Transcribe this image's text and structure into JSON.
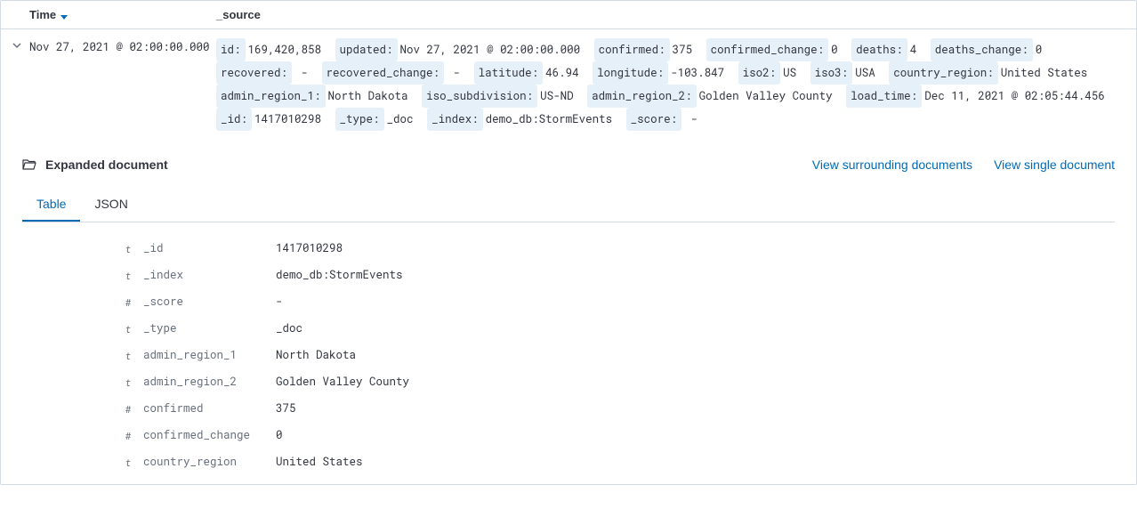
{
  "columns": {
    "time_label": "Time",
    "source_label": "_source"
  },
  "row": {
    "time": "Nov 27, 2021 @ 02:00:00.000",
    "source_fields": [
      {
        "key": "id:",
        "value": "169,420,858"
      },
      {
        "key": "updated:",
        "value": "Nov 27, 2021 @ 02:00:00.000"
      },
      {
        "key": "confirmed:",
        "value": "375"
      },
      {
        "key": "confirmed_change:",
        "value": "0"
      },
      {
        "key": "deaths:",
        "value": "4"
      },
      {
        "key": "deaths_change:",
        "value": "0"
      },
      {
        "key": "recovered:",
        "value": " - "
      },
      {
        "key": "recovered_change:",
        "value": " - "
      },
      {
        "key": "latitude:",
        "value": "46.94"
      },
      {
        "key": "longitude:",
        "value": "-103.847"
      },
      {
        "key": "iso2:",
        "value": "US"
      },
      {
        "key": "iso3:",
        "value": "USA"
      },
      {
        "key": "country_region:",
        "value": "United States"
      },
      {
        "key": "admin_region_1:",
        "value": "North Dakota"
      },
      {
        "key": "iso_subdivision:",
        "value": "US-ND"
      },
      {
        "key": "admin_region_2:",
        "value": "Golden Valley County"
      },
      {
        "key": "load_time:",
        "value": "Dec 11, 2021 @ 02:05:44.456"
      },
      {
        "key": "_id:",
        "value": "1417010298"
      },
      {
        "key": "_type:",
        "value": "_doc"
      },
      {
        "key": "_index:",
        "value": "demo_db:StormEvents"
      },
      {
        "key": "_score:",
        "value": " - "
      }
    ]
  },
  "expanded": {
    "title": "Expanded document",
    "link_surrounding": "View surrounding documents",
    "link_single": "View single document",
    "tabs": {
      "table": "Table",
      "json": "JSON"
    },
    "fields": [
      {
        "type": "t",
        "name": "_id",
        "value": "1417010298"
      },
      {
        "type": "t",
        "name": "_index",
        "value": "demo_db:StormEvents"
      },
      {
        "type": "#",
        "name": "_score",
        "value": " - "
      },
      {
        "type": "t",
        "name": "_type",
        "value": "_doc"
      },
      {
        "type": "t",
        "name": "admin_region_1",
        "value": "North Dakota"
      },
      {
        "type": "t",
        "name": "admin_region_2",
        "value": "Golden Valley County"
      },
      {
        "type": "#",
        "name": "confirmed",
        "value": "375"
      },
      {
        "type": "#",
        "name": "confirmed_change",
        "value": "0"
      },
      {
        "type": "t",
        "name": "country_region",
        "value": "United States"
      }
    ]
  }
}
